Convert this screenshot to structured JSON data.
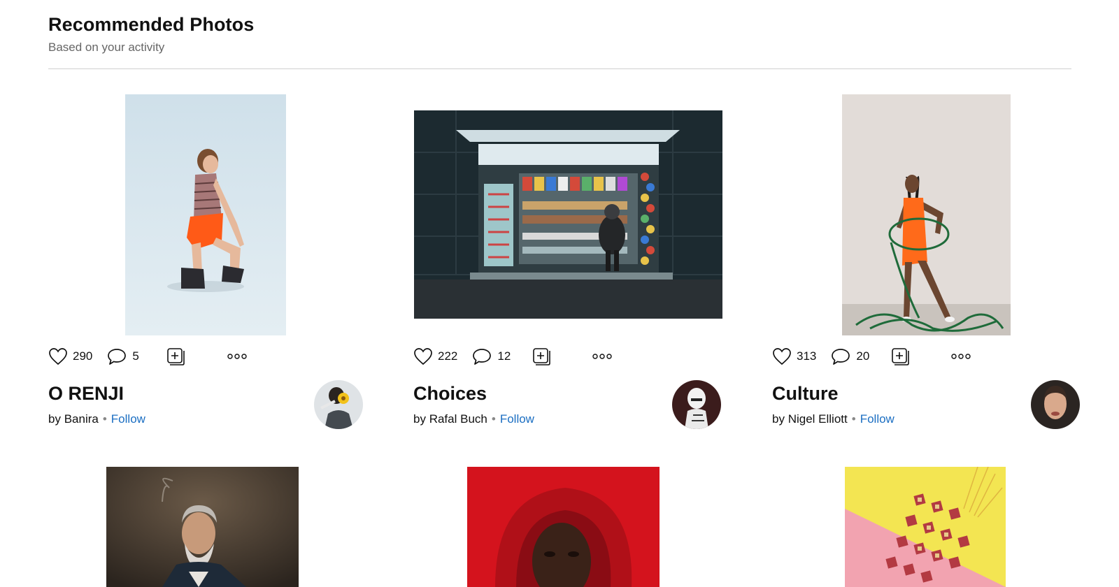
{
  "header": {
    "title": "Recommended Photos",
    "subtitle": "Based on your activity"
  },
  "cards": [
    {
      "title": "O RENJI",
      "by_prefix": "by",
      "author": "Banira",
      "follow": "Follow",
      "likes": "290",
      "comments": "5"
    },
    {
      "title": "Choices",
      "by_prefix": "by",
      "author": "Rafal Buch",
      "follow": "Follow",
      "likes": "222",
      "comments": "12"
    },
    {
      "title": "Culture",
      "by_prefix": "by",
      "author": "Nigel Elliott",
      "follow": "Follow",
      "likes": "313",
      "comments": "20"
    }
  ],
  "icons": {
    "like": "heart-icon",
    "comment": "speech-bubble-icon",
    "add": "add-to-gallery-icon",
    "more": "more-options-icon"
  },
  "colors": {
    "follow_link": "#1b6ec2",
    "divider": "#cfcfcf"
  }
}
